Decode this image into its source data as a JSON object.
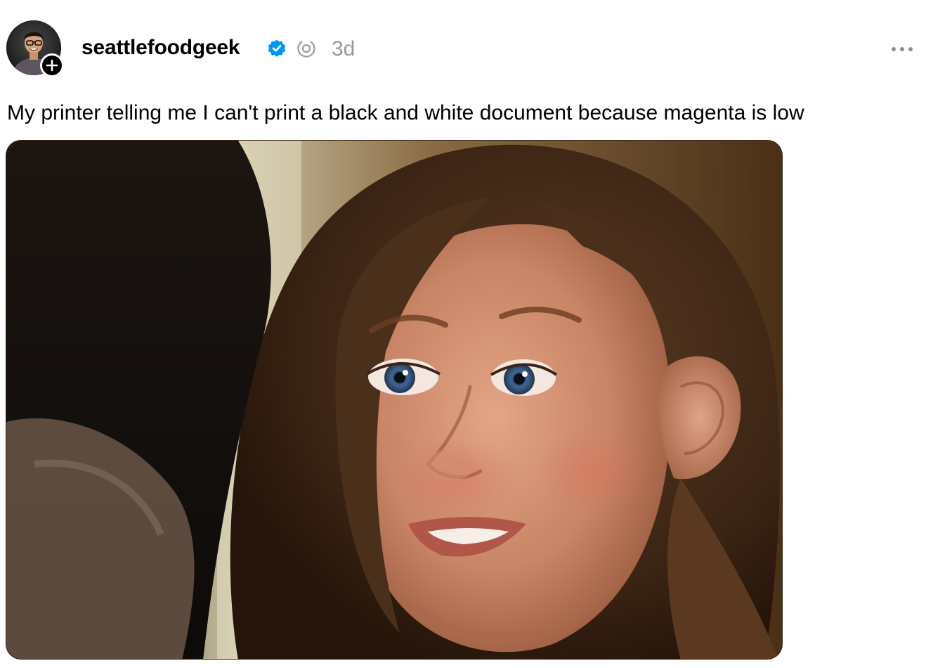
{
  "post": {
    "author": {
      "username": "seattlefoodgeek",
      "verified": true,
      "avatar_icon": "profile-photo",
      "follow_icon": "plus-icon"
    },
    "timestamp": "3d",
    "thread_icon": "threads-icon",
    "more_icon": "ellipsis-icon",
    "caption": "My printer telling me I can't print a black and white document because magenta is low",
    "media": {
      "type": "image",
      "alt": "Meme image: woman with wide-open blue eyes and a strained smile looking at someone in the foreground"
    }
  },
  "colors": {
    "text": "#000000",
    "muted": "#999999",
    "verified_blue": "#0095f6",
    "background": "#ffffff"
  }
}
